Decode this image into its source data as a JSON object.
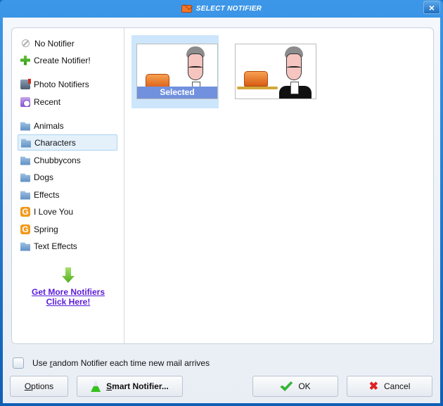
{
  "window": {
    "title": "Select Notifier",
    "close_label": "×"
  },
  "sidebar": {
    "items": [
      {
        "label": "No Notifier",
        "icon": "no-icon"
      },
      {
        "label": "Create Notifier!",
        "icon": "plus-icon"
      },
      {
        "label": "Photo Notifiers",
        "icon": "photo-icon"
      },
      {
        "label": "Recent",
        "icon": "recent-icon"
      },
      {
        "label": "Animals",
        "icon": "folder-icon"
      },
      {
        "label": "Characters",
        "icon": "folder-icon",
        "selected": true
      },
      {
        "label": "Chubbycons",
        "icon": "folder-icon"
      },
      {
        "label": "Dogs",
        "icon": "folder-icon"
      },
      {
        "label": "Effects",
        "icon": "folder-icon"
      },
      {
        "label": "I Love You",
        "icon": "g-icon"
      },
      {
        "label": "Spring",
        "icon": "g-icon"
      },
      {
        "label": "Text Effects",
        "icon": "folder-icon"
      }
    ],
    "get_more_line1": "Get More Notifiers",
    "get_more_line2": "Click Here!"
  },
  "thumbnails": [
    {
      "name": "butler-envelope",
      "selected": true,
      "selected_label": "Selected"
    },
    {
      "name": "butler-tray",
      "selected": false
    }
  ],
  "footer": {
    "random_checkbox_pre": "Use ",
    "random_checkbox_u": "r",
    "random_checkbox_post": "andom Notifier each time new mail arrives",
    "random_checked": false,
    "options_u": "O",
    "options_rest": "ptions",
    "smart_u": "S",
    "smart_rest": "mart Notifier...",
    "ok_label": "OK",
    "cancel_label": "Cancel"
  }
}
